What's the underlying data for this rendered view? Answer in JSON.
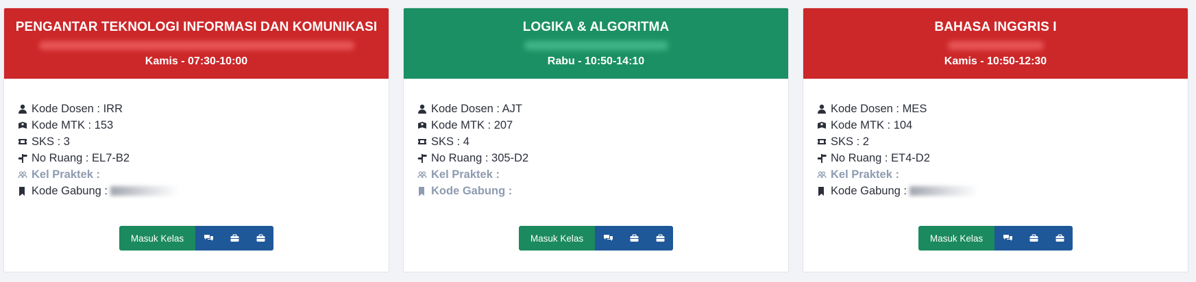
{
  "cards": [
    {
      "title": "PENGANTAR TEKNOLOGI INFORMASI DAN KOMUNIKASI",
      "schedule": "Kamis - 07:30-10:00",
      "header_color": "#cc2729",
      "lecturer_label": "Kode Dosen : IRR",
      "course_code_label": "Kode MTK : 153",
      "credits_label": "SKS : 3",
      "room_label": "No Ruang : EL7-B2",
      "practicum_label": "Kel Praktek :",
      "merge_code_label": "Kode Gabung :",
      "enter_button": "Masuk Kelas"
    },
    {
      "title": "LOGIKA & ALGORITMA",
      "schedule": "Rabu - 10:50-14:10",
      "header_color": "#1b9064",
      "lecturer_label": "Kode Dosen : AJT",
      "course_code_label": "Kode MTK : 207",
      "credits_label": "SKS : 4",
      "room_label": "No Ruang : 305-D2",
      "practicum_label": "Kel Praktek :",
      "merge_code_label": "Kode Gabung :",
      "enter_button": "Masuk Kelas"
    },
    {
      "title": "BAHASA INGGRIS I",
      "schedule": "Kamis - 10:50-12:30",
      "header_color": "#cc2729",
      "lecturer_label": "Kode Dosen : MES",
      "course_code_label": "Kode MTK : 104",
      "credits_label": "SKS : 2",
      "room_label": "No Ruang : ET4-D2",
      "practicum_label": "Kel Praktek :",
      "merge_code_label": "Kode Gabung :",
      "enter_button": "Masuk Kelas"
    }
  ],
  "icons": {
    "lecturer": "user-icon",
    "course_code": "book-icon",
    "credits": "ticket-icon",
    "room": "signpost-icon",
    "practicum": "users-icon",
    "merge_code": "bookmark-icon",
    "discussion": "comments-icon",
    "assignment": "briefcase-icon",
    "attendance": "briefcase-icon"
  }
}
